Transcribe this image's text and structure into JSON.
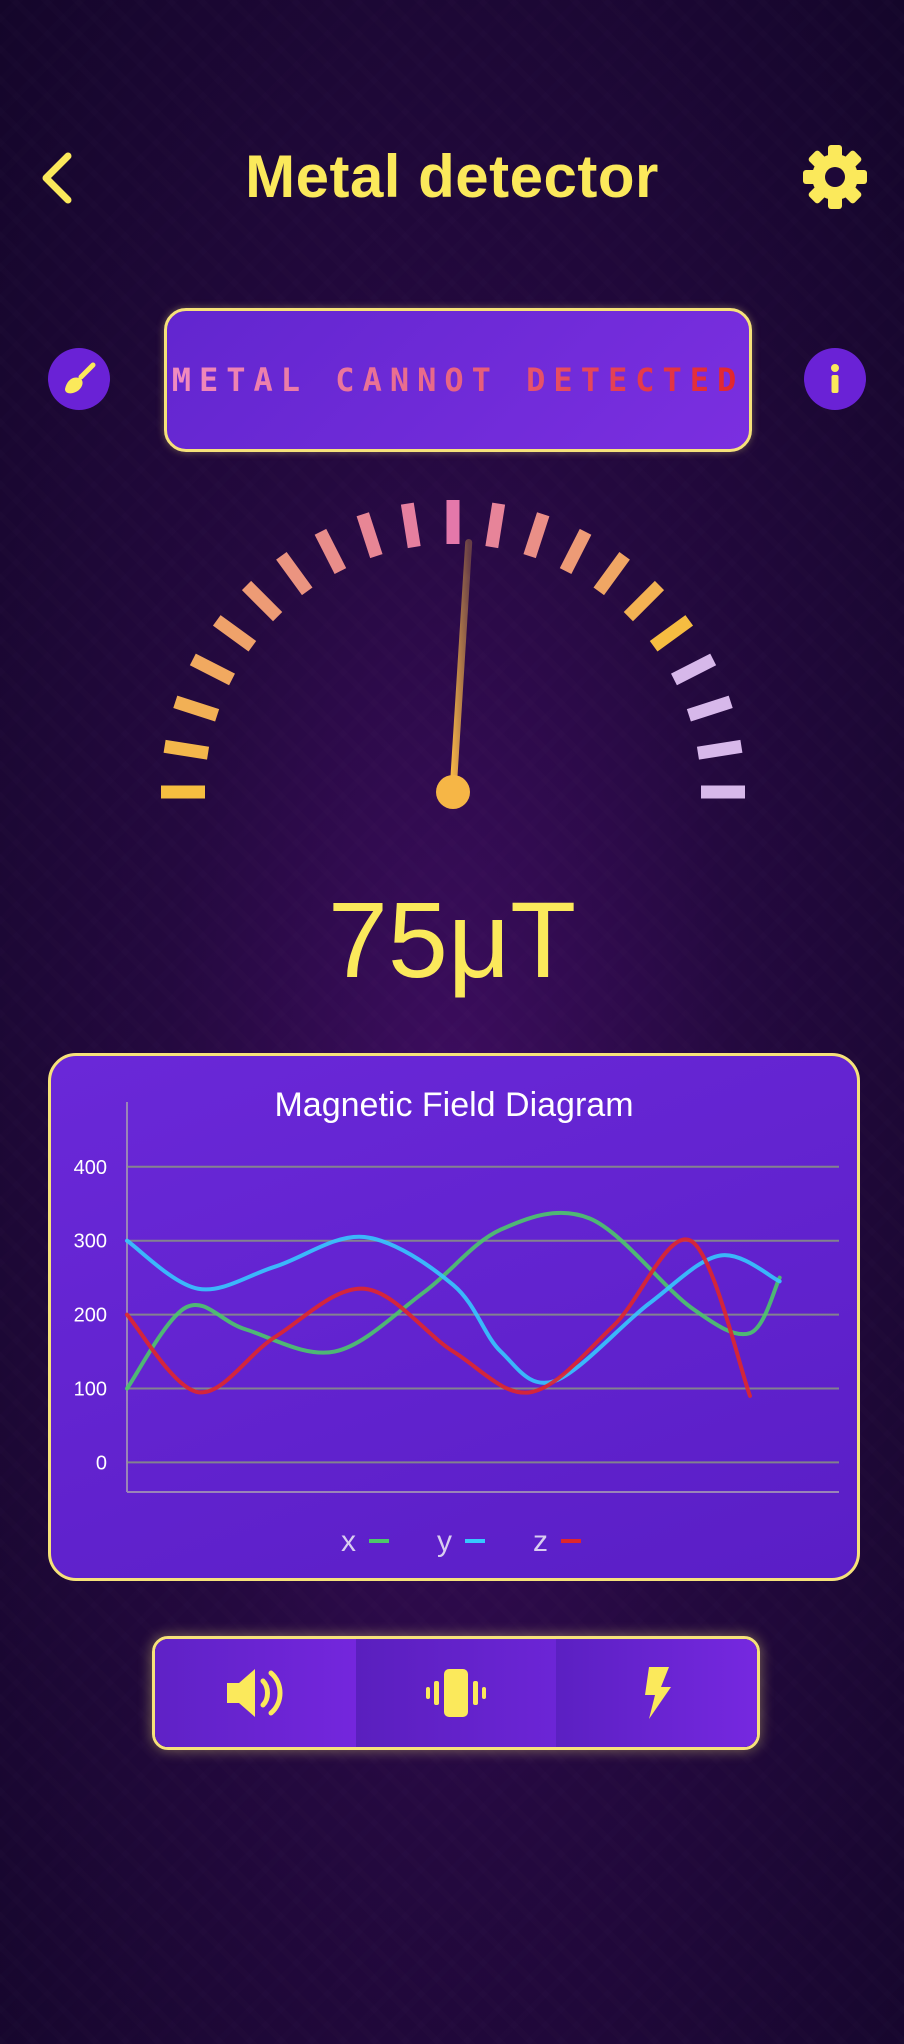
{
  "header": {
    "title": "Metal detector"
  },
  "status": {
    "text": "METAL CANNOT DETECTED"
  },
  "reading": {
    "value": "75μT"
  },
  "colors": {
    "accent": "#fbe95b",
    "card": "#6226cf",
    "x": "#4dc86a",
    "y": "#36c8ff",
    "z": "#e0262b"
  },
  "icons": {
    "back": "chevron-left-icon",
    "settings": "gear-icon",
    "clean": "brush-icon",
    "info": "info-icon",
    "sound": "speaker-icon",
    "vibrate": "vibrate-icon",
    "flash": "flash-icon"
  },
  "gauge": {
    "level": 0.52
  },
  "chart_data": {
    "type": "line",
    "title": "Magnetic Field Diagram",
    "ylim": [
      -40,
      420
    ],
    "yticks": [
      0,
      100,
      200,
      300,
      400
    ],
    "grid": true,
    "legend_position": "bottom-center",
    "series": [
      {
        "name": "x",
        "color": "#4dc86a",
        "x": [
          0,
          10,
          20,
          35,
          50,
          63,
          78,
          95,
          105,
          110
        ],
        "y": [
          100,
          210,
          180,
          150,
          230,
          315,
          330,
          210,
          175,
          250
        ]
      },
      {
        "name": "y",
        "color": "#36c8ff",
        "x": [
          0,
          12,
          25,
          40,
          55,
          63,
          72,
          88,
          100,
          110
        ],
        "y": [
          300,
          235,
          265,
          305,
          240,
          150,
          110,
          215,
          280,
          245
        ]
      },
      {
        "name": "z",
        "color": "#e0262b",
        "x": [
          0,
          12,
          25,
          40,
          55,
          68,
          82,
          95,
          105
        ],
        "y": [
          200,
          95,
          170,
          235,
          150,
          95,
          185,
          300,
          90
        ]
      }
    ],
    "legend": [
      "x",
      "y",
      "z"
    ]
  }
}
